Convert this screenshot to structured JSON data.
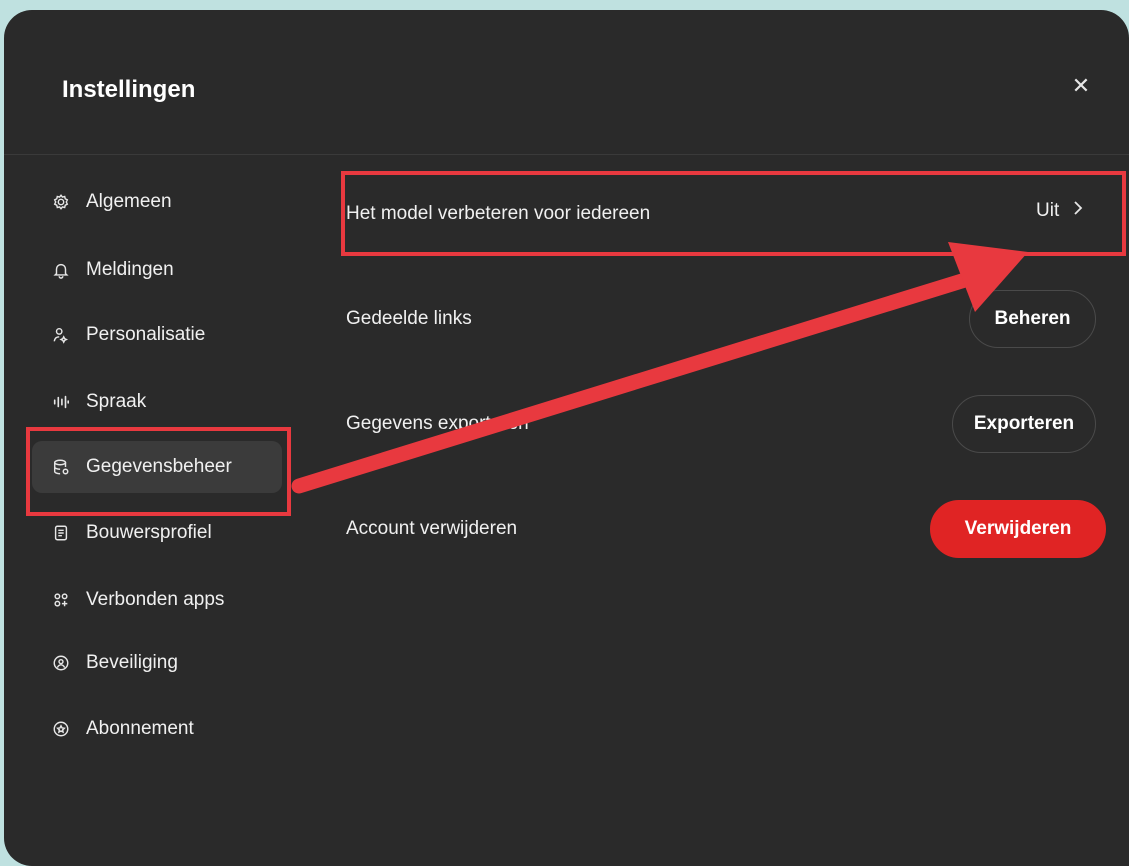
{
  "dialog": {
    "title": "Instellingen",
    "close_icon": "close-icon"
  },
  "sidebar": {
    "items": [
      {
        "label": "Algemeen",
        "icon": "gear-icon"
      },
      {
        "label": "Meldingen",
        "icon": "bell-icon"
      },
      {
        "label": "Personalisatie",
        "icon": "user-sparkle-icon"
      },
      {
        "label": "Spraak",
        "icon": "waveform-icon"
      },
      {
        "label": "Gegevensbeheer",
        "icon": "database-icon",
        "active": true
      },
      {
        "label": "Bouwersprofiel",
        "icon": "id-card-icon"
      },
      {
        "label": "Verbonden apps",
        "icon": "apps-grid-icon"
      },
      {
        "label": "Beveiliging",
        "icon": "shield-icon"
      },
      {
        "label": "Abonnement",
        "icon": "badge-icon"
      }
    ]
  },
  "main": {
    "rows": [
      {
        "label": "Het model verbeteren voor iedereen",
        "value": "Uit"
      },
      {
        "label": "Gedeelde links",
        "button": "Beheren"
      },
      {
        "label": "Gegevens exporteren",
        "button": "Exporteren"
      },
      {
        "label": "Account verwijderen",
        "button": "Verwijderen"
      }
    ]
  },
  "colors": {
    "background": "#bfe1e0",
    "dialog": "#2a2a2a",
    "danger": "#e02424",
    "annotation": "#e8393f"
  }
}
